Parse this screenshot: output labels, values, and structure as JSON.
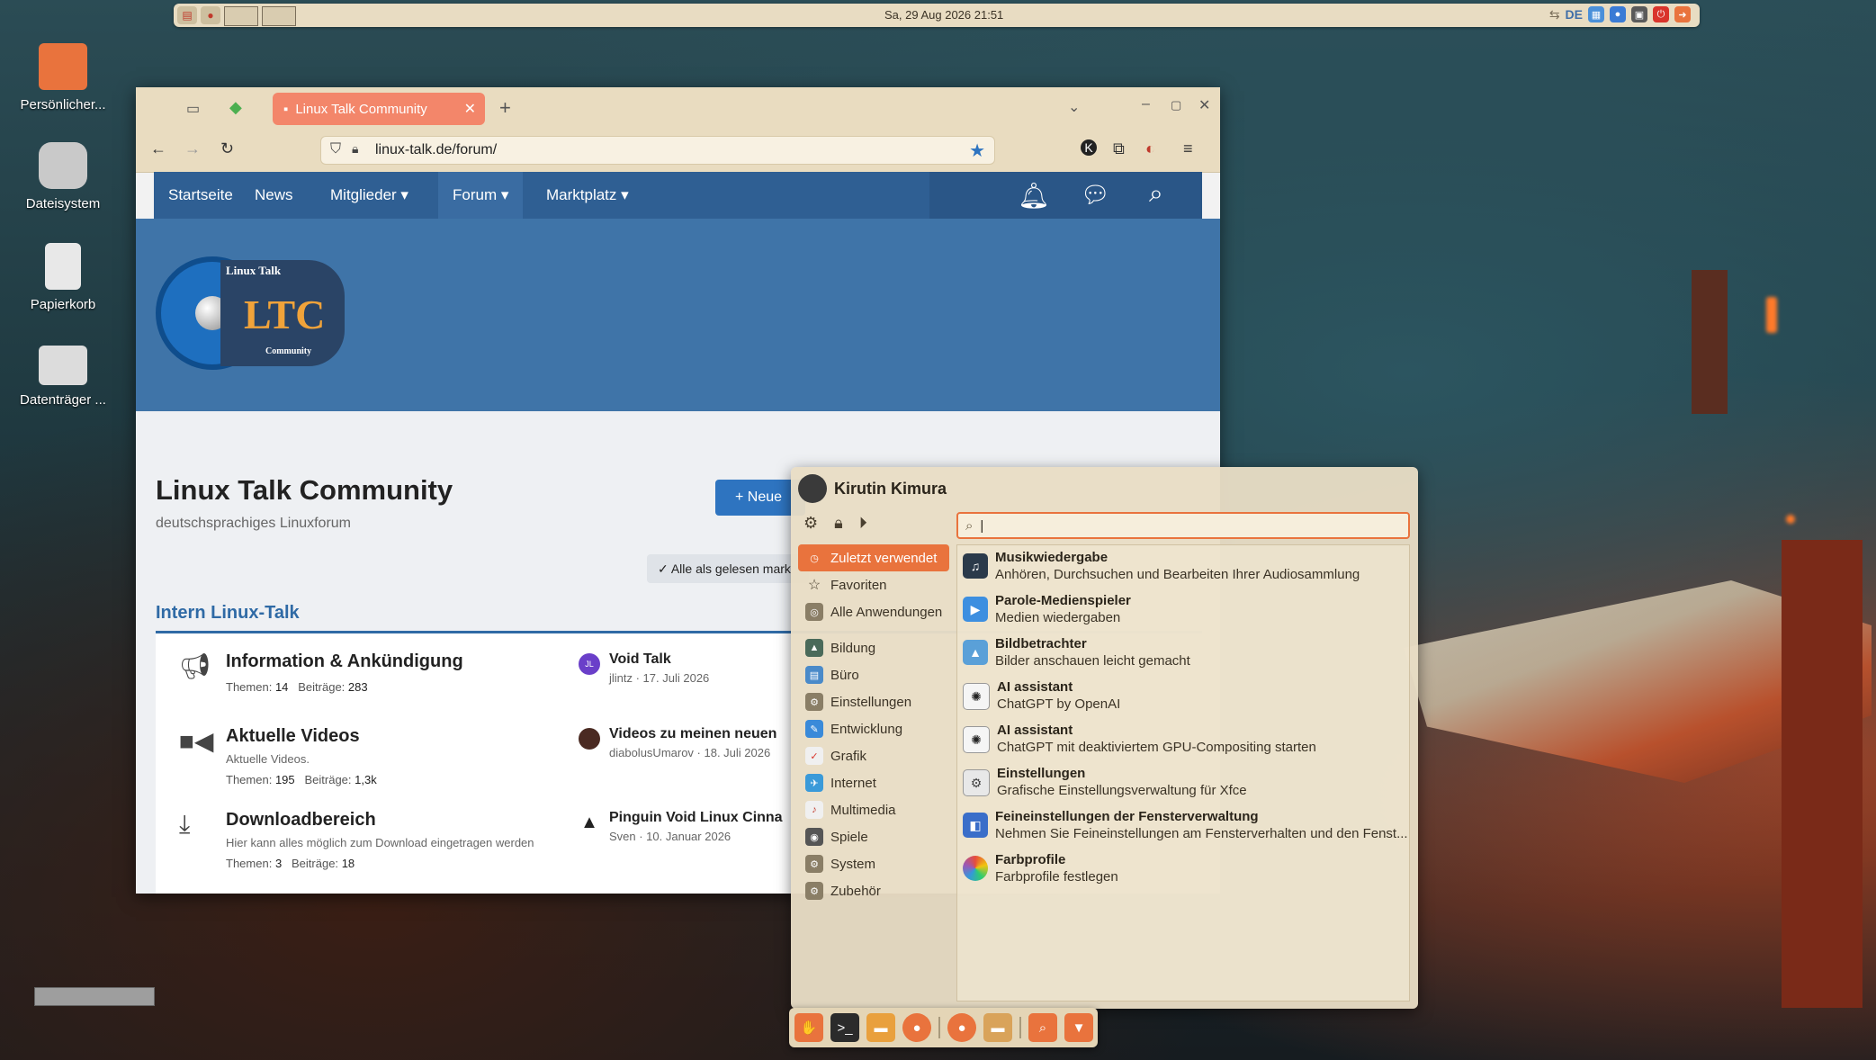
{
  "top_panel": {
    "clock": "Sa, 29 Aug 2026   21:51",
    "language": "DE"
  },
  "desktop": {
    "icons": [
      {
        "label": "Persönlicher..."
      },
      {
        "label": "Dateisystem"
      },
      {
        "label": "Papierkorb"
      },
      {
        "label": "Datenträger ..."
      }
    ]
  },
  "browser": {
    "tab_title": "Linux Talk Community",
    "url": "linux-talk.de/forum/",
    "nav": {
      "items": [
        "Startseite",
        "News",
        "Mitglieder ▾",
        "Forum ▾",
        "Marktplatz ▾"
      ]
    },
    "logo": {
      "text_top": "Linux Talk",
      "text_main": "LTC",
      "text_bottom": "Community"
    },
    "page_title": "Linux Talk Community",
    "page_subtitle": "deutschsprachiges Linuxforum",
    "new_button": "+ Neue",
    "mark_read_button": "✓ Alle als gelesen mark",
    "section_title": "Intern Linux-Talk",
    "forums": [
      {
        "name": "Information & Ankündigung",
        "description": "",
        "threads_label": "Themen:",
        "threads": "14",
        "posts_label": "Beiträge:",
        "posts": "283",
        "last_title": "Void Talk",
        "last_meta": "jlintz · 17. Juli 2026",
        "avatar_text": "JL"
      },
      {
        "name": "Aktuelle Videos",
        "description": "Aktuelle Videos.",
        "threads_label": "Themen:",
        "threads": "195",
        "posts_label": "Beiträge:",
        "posts": "1,3k",
        "last_title": "Videos zu meinen neuen",
        "last_meta": "diabolusUmarov · 18. Juli 2026",
        "avatar_text": ""
      },
      {
        "name": "Downloadbereich",
        "description": "Hier kann alles möglich zum Download eingetragen werden",
        "threads_label": "Themen:",
        "threads": "3",
        "posts_label": "Beiträge:",
        "posts": "18",
        "last_title": "Pinguin Void Linux Cinna",
        "last_meta": "Sven · 10. Januar 2026",
        "avatar_text": ""
      }
    ]
  },
  "app_menu": {
    "user": "Kirutin Kimura",
    "search_value": "",
    "categories_top": [
      {
        "label": "Zuletzt verwendet",
        "active": true
      },
      {
        "label": "Favoriten",
        "active": false
      },
      {
        "label": "Alle Anwendungen",
        "active": false
      }
    ],
    "categories": [
      "Bildung",
      "Büro",
      "Einstellungen",
      "Entwicklung",
      "Grafik",
      "Internet",
      "Multimedia",
      "Spiele",
      "System",
      "Zubehör"
    ],
    "apps": [
      {
        "name": "Musikwiedergabe",
        "desc": "Anhören, Durchsuchen und Bearbeiten Ihrer Audiosammlung",
        "color": "#2b3a4a"
      },
      {
        "name": "Parole-Medienspieler",
        "desc": "Medien wiedergaben",
        "color": "#3d8fe0"
      },
      {
        "name": "Bildbetrachter",
        "desc": "Bilder anschauen leicht gemacht",
        "color": "#5aa0d8"
      },
      {
        "name": "AI assistant",
        "desc": "ChatGPT by OpenAI",
        "color": "#f5f5f5"
      },
      {
        "name": "AI assistant",
        "desc": "ChatGPT mit deaktiviertem GPU-Compositing starten",
        "color": "#f5f5f5"
      },
      {
        "name": "Einstellungen",
        "desc": "Grafische Einstellungsverwaltung für Xfce",
        "color": "#e8e8e8"
      },
      {
        "name": "Feineinstellungen der Fensterverwaltung",
        "desc": "Nehmen Sie Feineinstellungen am Fensterverhalten und den Fenst...",
        "color": "#3a6ec9"
      },
      {
        "name": "Farbprofile",
        "desc": "Farbprofile festlegen",
        "color": "#f0f0f0"
      }
    ]
  }
}
